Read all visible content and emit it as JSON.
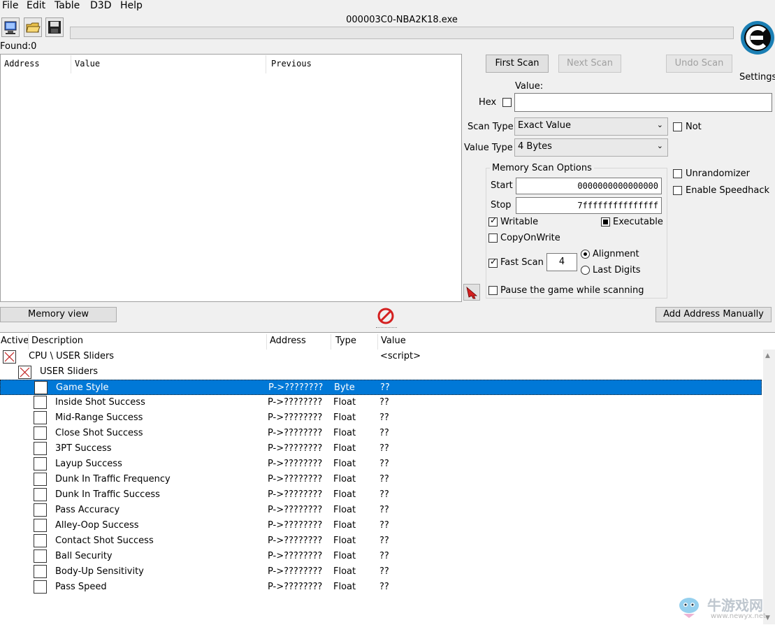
{
  "menu": [
    "File",
    "Edit",
    "Table",
    "D3D",
    "Help"
  ],
  "process_title": "000003C0-NBA2K18.exe",
  "found_label": "Found:",
  "found_count": "0",
  "results_columns": [
    "Address",
    "Value",
    "Previous"
  ],
  "buttons": {
    "first_scan": "First Scan",
    "next_scan": "Next Scan",
    "undo_scan": "Undo Scan",
    "memory_view": "Memory view",
    "add_address": "Add Address Manually"
  },
  "settings_label": "Settings",
  "scan": {
    "value_label": "Value:",
    "hex_label": "Hex",
    "value": "",
    "scan_type_label": "Scan Type",
    "scan_type_value": "Exact Value",
    "value_type_label": "Value Type",
    "value_type_value": "4 Bytes",
    "not_label": "Not",
    "unrandomizer_label": "Unrandomizer",
    "speedhack_label": "Enable Speedhack"
  },
  "memory_options": {
    "title": "Memory Scan Options",
    "start_label": "Start",
    "start_value": "0000000000000000",
    "stop_label": "Stop",
    "stop_value": "7fffffffffffffff",
    "writable_label": "Writable",
    "executable_label": "Executable",
    "copyonwrite_label": "CopyOnWrite",
    "fastscan_label": "Fast Scan",
    "fastscan_value": "4",
    "alignment_label": "Alignment",
    "lastdigits_label": "Last Digits",
    "pause_label": "Pause the game while scanning"
  },
  "table_columns": [
    "Active",
    "Description",
    "Address",
    "Type",
    "Value"
  ],
  "table_groups": [
    {
      "description": "CPU \\ USER Sliders",
      "value": "<script>"
    },
    {
      "description": "USER Sliders",
      "value": ""
    }
  ],
  "table_rows": [
    {
      "description": "Game Style",
      "address": "P->????????",
      "type": "Byte",
      "value": "??"
    },
    {
      "description": "Inside Shot Success",
      "address": "P->????????",
      "type": "Float",
      "value": "??"
    },
    {
      "description": "Mid-Range Success",
      "address": "P->????????",
      "type": "Float",
      "value": "??"
    },
    {
      "description": "Close Shot Success",
      "address": "P->????????",
      "type": "Float",
      "value": "??"
    },
    {
      "description": "3PT Success",
      "address": "P->????????",
      "type": "Float",
      "value": "??"
    },
    {
      "description": "Layup Success",
      "address": "P->????????",
      "type": "Float",
      "value": "??"
    },
    {
      "description": "Dunk In Traffic Frequency",
      "address": "P->????????",
      "type": "Float",
      "value": "??"
    },
    {
      "description": "Dunk In Traffic Success",
      "address": "P->????????",
      "type": "Float",
      "value": "??"
    },
    {
      "description": "Pass Accuracy",
      "address": "P->????????",
      "type": "Float",
      "value": "??"
    },
    {
      "description": "Alley-Oop Success",
      "address": "P->????????",
      "type": "Float",
      "value": "??"
    },
    {
      "description": "Contact Shot Success",
      "address": "P->????????",
      "type": "Float",
      "value": "??"
    },
    {
      "description": "Ball Security",
      "address": "P->????????",
      "type": "Float",
      "value": "??"
    },
    {
      "description": "Body-Up Sensitivity",
      "address": "P->????????",
      "type": "Float",
      "value": "??"
    },
    {
      "description": "Pass Speed",
      "address": "P->????????",
      "type": "Float",
      "value": "??"
    }
  ],
  "watermark": {
    "cn": "牛游戏网",
    "url": "www.newyx.net"
  },
  "colors": {
    "selection": "#0078d7",
    "logo": "#1b7fb4",
    "stop_icon": "#d42020"
  }
}
